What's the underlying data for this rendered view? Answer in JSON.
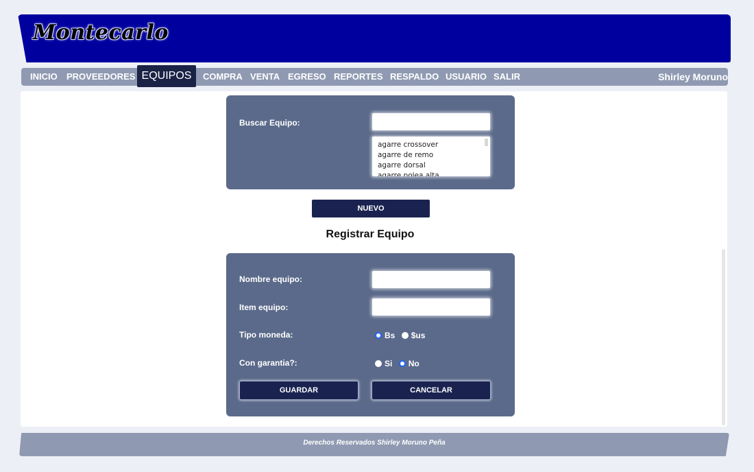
{
  "header": {
    "logo": "Montecarlo"
  },
  "nav": {
    "items": [
      "INICIO",
      "PROVEEDORES",
      "EQUIPOS",
      "COMPRA",
      "VENTA",
      "EGRESO",
      "REPORTES",
      "RESPALDO",
      "USUARIO",
      "SALIR"
    ],
    "active": "EQUIPOS",
    "user": "Shirley Moruno"
  },
  "search": {
    "label": "Buscar Equipo:",
    "value": "",
    "options": [
      "agarre crossover",
      "agarre de remo",
      "agarre dorsal",
      "agarre polea alta"
    ]
  },
  "new_button": "NUEVO",
  "form": {
    "title": "Registrar Equipo",
    "name_label": "Nombre equipo:",
    "name_value": "",
    "item_label": "Item equipo:",
    "item_value": "",
    "currency_label": "Tipo moneda:",
    "currency_options": [
      "Bs",
      "$us"
    ],
    "currency_selected": "Bs",
    "warranty_label": "Con garantia?:",
    "warranty_options": [
      "Si",
      "No"
    ],
    "warranty_selected": "No",
    "save": "GUARDAR",
    "cancel": "CANCELAR"
  },
  "footer": "Derechos Reservados Shirley Moruno Peña",
  "colors": {
    "header": "#00009f",
    "nav": "#8f9ab2",
    "panel": "#5b6a8a",
    "button": "#1a2350",
    "radio_selected": "#1e64ff"
  }
}
